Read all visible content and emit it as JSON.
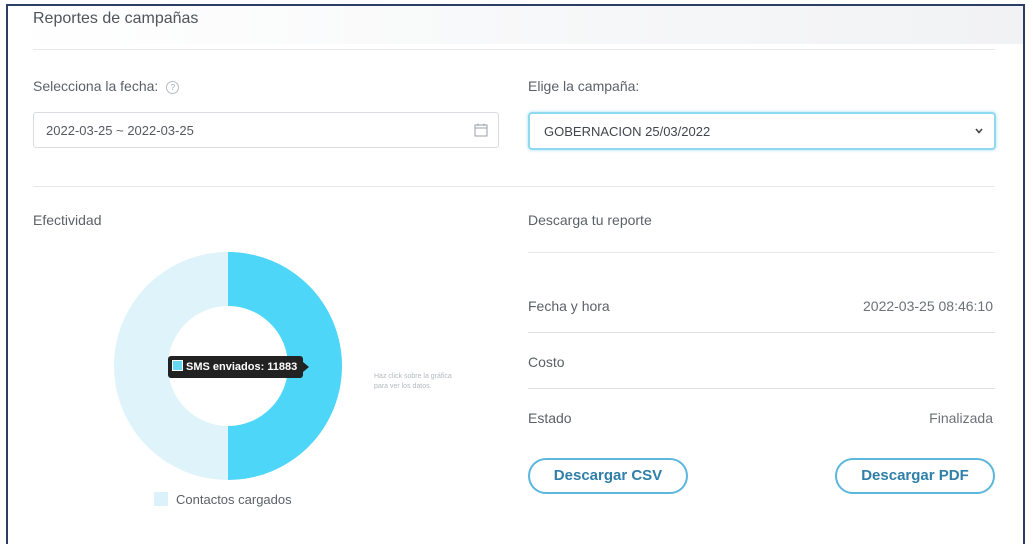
{
  "header": {
    "title": "Reportes de campañas"
  },
  "filters": {
    "date_label": "Selecciona la fecha:",
    "date_value": "2022-03-25 ~ 2022-03-25",
    "campaign_label": "Elige la campaña:",
    "campaign_selected": "GOBERNACION 25/03/2022"
  },
  "effectiveness": {
    "title": "Efectividad",
    "tooltip": "SMS enviados: 11883",
    "hint": "Haz click sobre la gráfica para ver los datos.",
    "legend": "Contactos cargados"
  },
  "chart_data": {
    "type": "pie",
    "donut": true,
    "series": [
      {
        "name": "SMS enviados",
        "value": 11883,
        "color": "#4dd6f8"
      },
      {
        "name": "Contactos cargados",
        "value": 11883,
        "color": "#dff3fb"
      }
    ]
  },
  "report": {
    "title": "Descarga tu reporte",
    "rows": [
      {
        "label": "Fecha y hora",
        "value": "2022-03-25 08:46:10"
      },
      {
        "label": "Costo",
        "value": ""
      },
      {
        "label": "Estado",
        "value": "Finalizada"
      }
    ],
    "csv_button": "Descargar CSV",
    "pdf_button": "Descargar PDF"
  }
}
